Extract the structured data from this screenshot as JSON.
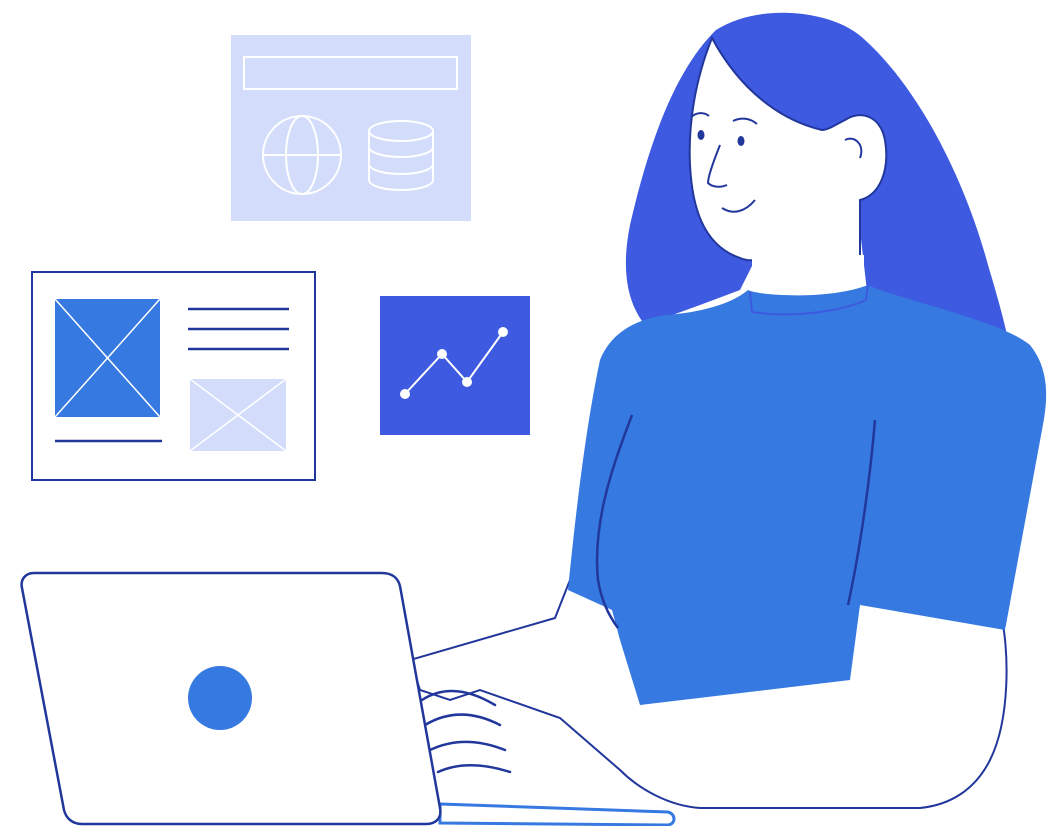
{
  "illustration": {
    "subject": "woman-working-on-laptop",
    "colors": {
      "hair": "#3d5ae0",
      "shirt": "#3679e0",
      "outline": "#22379c",
      "skin": "#ffffff",
      "pale_card": "#d3ddfb",
      "chart_card": "#3d5ae0",
      "image_block": "#3679e0",
      "laptop_logo": "#3679e0",
      "keyboard_base": "#3679e0"
    },
    "icons": {
      "globe": "globe-icon",
      "database": "database-icon",
      "trend": "trend-line-icon",
      "image_placeholder": "image-placeholder-icon"
    }
  }
}
